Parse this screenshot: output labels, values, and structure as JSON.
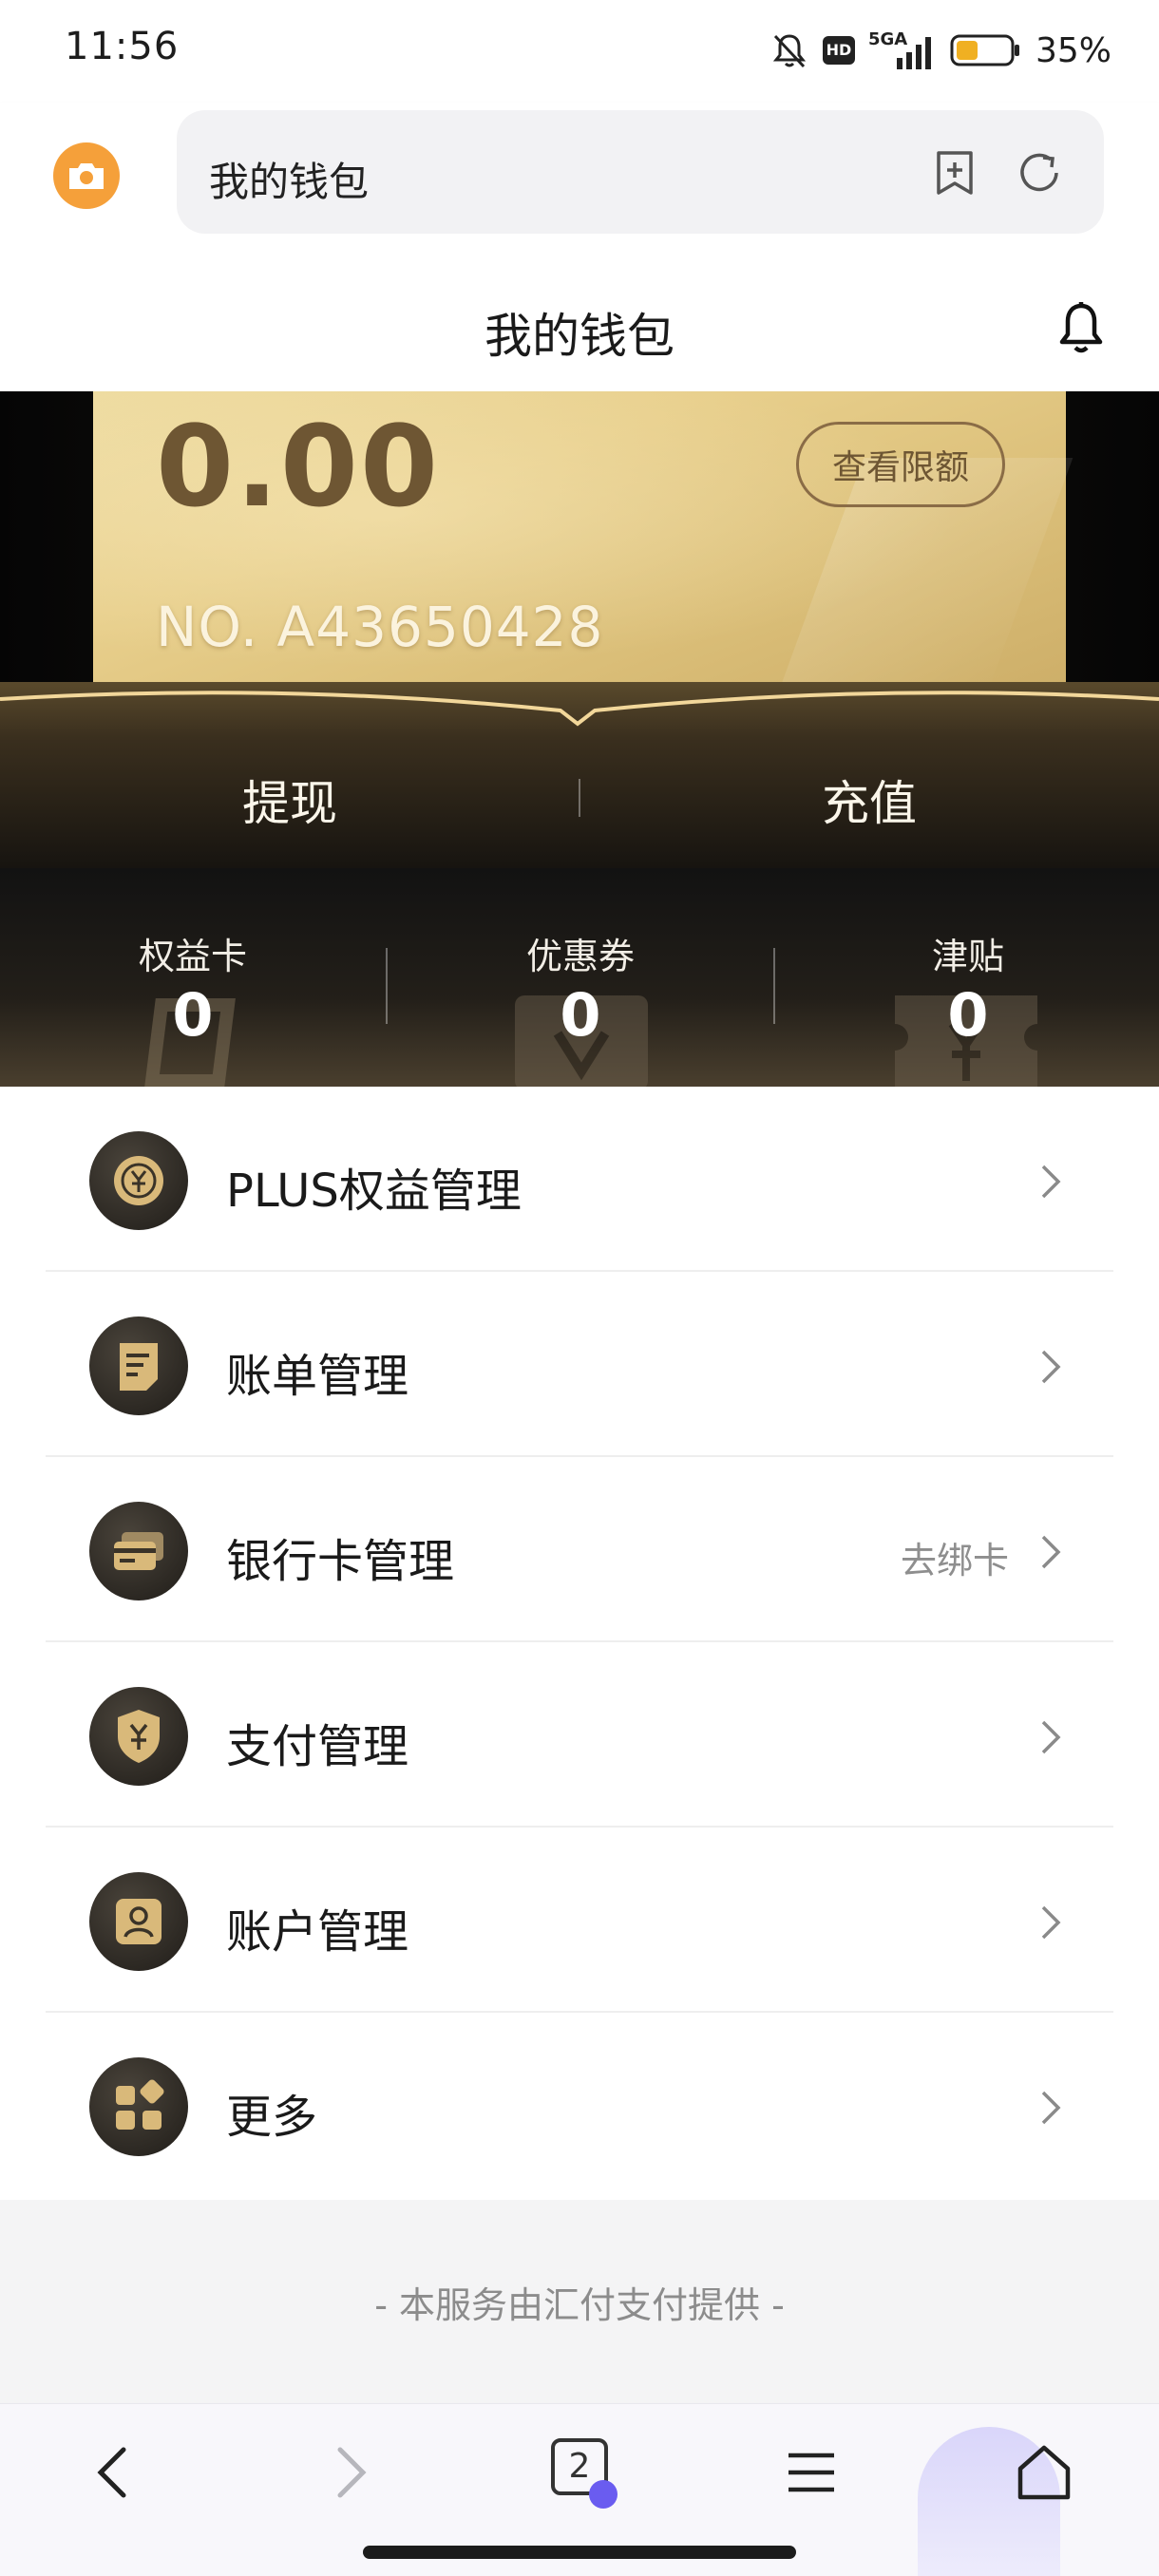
{
  "status_bar": {
    "time": "11:56",
    "network": "5GA",
    "hd_label": "HD",
    "battery_percent": "35%"
  },
  "browser": {
    "url_text": "我的钱包",
    "camera_icon": "camera-icon",
    "bookmark_icon": "bookmark-add-icon",
    "refresh_icon": "refresh-icon",
    "accent_color": "#f5a03a"
  },
  "page": {
    "title": "我的钱包",
    "bell_icon": "bell-icon"
  },
  "wallet": {
    "balance": "0.00",
    "limit_button": "查看限额",
    "card_no": "NO. A43650428",
    "withdraw_label": "提现",
    "recharge_label": "充值",
    "card_colors": {
      "gold_light": "#eedba0",
      "gold_dark": "#cdae68",
      "text_brown": "#6e5633"
    }
  },
  "stats": [
    {
      "label": "权益卡",
      "value": "0"
    },
    {
      "label": "优惠券",
      "value": "0"
    },
    {
      "label": "津贴",
      "value": "0"
    }
  ],
  "menu": [
    {
      "label": "PLUS权益管理",
      "hint": "",
      "icon": "plus-coin-icon"
    },
    {
      "label": "账单管理",
      "hint": "",
      "icon": "bill-icon"
    },
    {
      "label": "银行卡管理",
      "hint": "去绑卡",
      "icon": "bank-card-icon"
    },
    {
      "label": "支付管理",
      "hint": "",
      "icon": "payment-shield-icon"
    },
    {
      "label": "账户管理",
      "hint": "",
      "icon": "account-icon"
    },
    {
      "label": "更多",
      "hint": "",
      "icon": "more-grid-icon"
    }
  ],
  "footer": {
    "provider_note": "- 本服务由汇付支付提供 -"
  },
  "bottom_nav": {
    "tab_count": "2",
    "back_icon": "back-arrow-icon",
    "forward_icon": "forward-arrow-icon",
    "menu_icon": "hamburger-menu-icon",
    "home_icon": "home-icon"
  }
}
